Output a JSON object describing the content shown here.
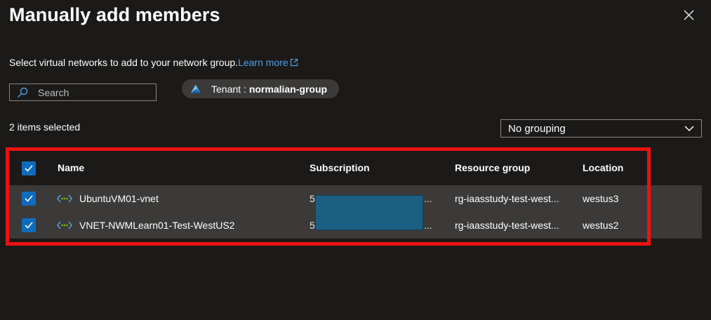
{
  "dialog": {
    "title": "Manually add members",
    "description": "Select virtual networks to add to your network group.",
    "learn_more": "Learn more"
  },
  "search": {
    "placeholder": "Search"
  },
  "tenant": {
    "label": "Tenant :",
    "value": "normalian-group"
  },
  "selection": {
    "count_text": "2 items selected"
  },
  "grouping": {
    "selected": "No grouping"
  },
  "table": {
    "headers": {
      "name": "Name",
      "subscription": "Subscription",
      "resource_group": "Resource group",
      "location": "Location"
    },
    "rows": [
      {
        "name": "UbuntuVM01-vnet",
        "subscription": "5",
        "subscription_tail": "l...",
        "resource_group": "rg-iaasstudy-test-west...",
        "location": "westus3",
        "checked": true
      },
      {
        "name": "VNET-NWMLearn01-Test-WestUS2",
        "subscription": "5",
        "subscription_tail": "l...",
        "resource_group": "rg-iaasstudy-test-west...",
        "location": "westus2",
        "checked": true
      }
    ]
  },
  "icons": {
    "close": "close-icon",
    "search": "search-icon",
    "tenant": "tenant-icon",
    "external_link": "external-link-icon",
    "chevron": "chevron-down-icon",
    "vnet": "virtual-network-icon",
    "check": "checkmark-icon"
  },
  "colors": {
    "background": "#1b1a19",
    "row_background": "#3b3a39",
    "accent": "#0f6cbd",
    "link": "#4f9fe8",
    "highlight_border": "#ee1111",
    "redaction": "#1b5f82"
  }
}
